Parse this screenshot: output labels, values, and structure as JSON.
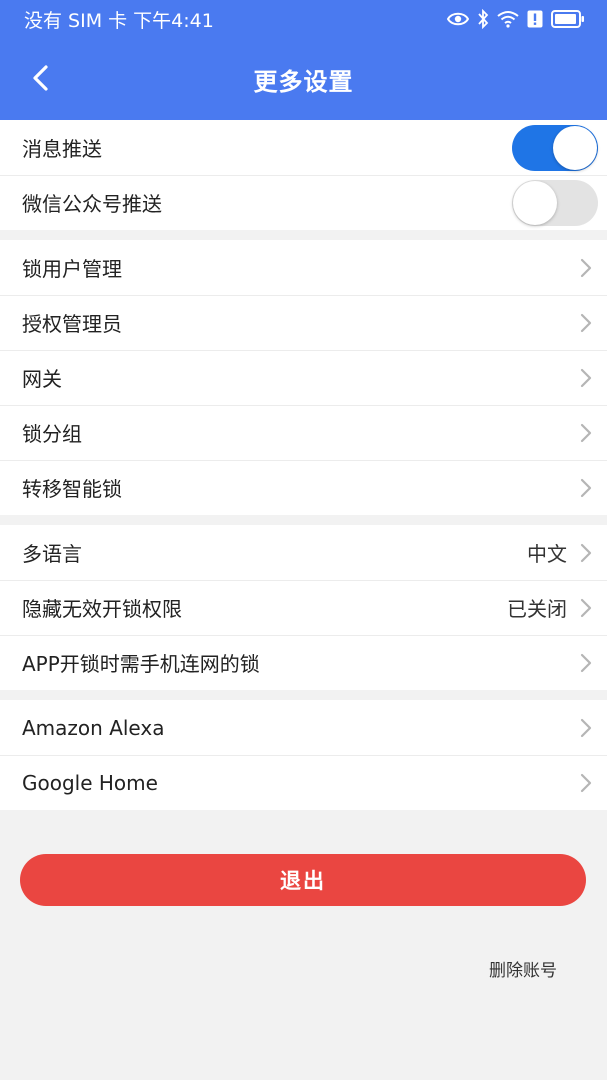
{
  "status_bar": {
    "left_text": "没有 SIM 卡 下午4:41",
    "icons": [
      "eye-icon",
      "bluetooth-icon",
      "wifi-icon",
      "alert-icon",
      "battery-icon"
    ]
  },
  "header": {
    "title": "更多设置",
    "back_icon": "chevron-left-icon",
    "bg_color": "#4a7af0"
  },
  "notifications": [
    {
      "label": "消息推送",
      "enabled": true
    },
    {
      "label": "微信公众号推送",
      "enabled": false
    }
  ],
  "management": [
    {
      "label": "锁用户管理"
    },
    {
      "label": "授权管理员"
    },
    {
      "label": "网关"
    },
    {
      "label": "锁分组"
    },
    {
      "label": "转移智能锁"
    }
  ],
  "preferences": [
    {
      "label": "多语言",
      "value": "中文"
    },
    {
      "label": "隐藏无效开锁权限",
      "value": "已关闭"
    },
    {
      "label": "APP开锁时需手机连网的锁",
      "value": ""
    }
  ],
  "integrations": [
    {
      "label": "Amazon Alexa"
    },
    {
      "label": "Google Home"
    }
  ],
  "logout_label": "退出",
  "delete_account_label": "删除账号",
  "colors": {
    "toggle_on": "#1f75e6",
    "toggle_off": "#e3e3e3",
    "logout": "#ea4641"
  }
}
